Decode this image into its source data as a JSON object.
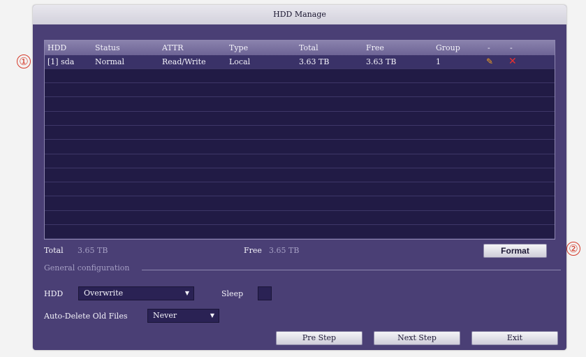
{
  "window": {
    "title": "HDD Manage"
  },
  "callouts": [
    "①",
    "②"
  ],
  "table": {
    "headers": [
      "HDD",
      "Status",
      "ATTR",
      "Type",
      "Total",
      "Free",
      "Group",
      "-",
      "-"
    ],
    "rows": [
      {
        "hdd": "[1] sda",
        "status": "Normal",
        "attr": "Read/Write",
        "type": "Local",
        "total": "3.63 TB",
        "free": "3.63 TB",
        "group": "1",
        "edit_icon": "pencil-icon",
        "delete_icon": "delete-x-icon"
      }
    ],
    "empty_rows": 12
  },
  "summary": {
    "total_label": "Total",
    "total_value": "3.65 TB",
    "free_label": "Free",
    "free_value": "3.65 TB",
    "format_label": "Format"
  },
  "general": {
    "section_label": "General configuration",
    "hdd_label": "HDD",
    "hdd_mode": "Overwrite",
    "sleep_label": "Sleep",
    "sleep_checked": false,
    "auto_delete_label": "Auto-Delete Old Files",
    "auto_delete_value": "Never"
  },
  "footer": {
    "pre_step": "Pre Step",
    "next_step": "Next Step",
    "exit": "Exit"
  },
  "colors": {
    "background": "#4a3f75",
    "panel": "#211b45",
    "header": "#7a71a1",
    "callout": "#d53a2a",
    "edit_icon": "#f0a020",
    "delete_icon": "#e83030"
  }
}
